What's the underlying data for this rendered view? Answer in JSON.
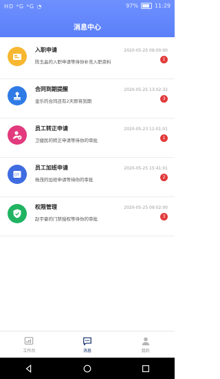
{
  "status": {
    "left": "HD ⁴G ⁴G ◔",
    "battery": "97%",
    "time": "11:29"
  },
  "header": {
    "title": "消息中心"
  },
  "messages": [
    {
      "title": "入职申请",
      "desc": "陈玉晶的入职申请等待你补充入职资料",
      "time": "2020-05-25 09:00:00",
      "badge": "1",
      "color": "#f7b731",
      "icon": "id-card-icon"
    },
    {
      "title": "合同到期提醒",
      "desc": "金乐的合同还有2天即将到期",
      "time": "2020-05-25 13:02:32",
      "badge": "3",
      "color": "#2f7be6",
      "icon": "stamp-icon"
    },
    {
      "title": "员工转正申请",
      "desc": "卫健民的转正申请等待你的审批",
      "time": "2020-05-23 11:01:01",
      "badge": "1",
      "color": "#e23a7c",
      "icon": "verified-user-icon"
    },
    {
      "title": "员工加班申请",
      "desc": "杨茂的加班申请等待你的审批",
      "time": "2020-05-25 15:41:01",
      "badge": "2",
      "color": "#3f6ce1",
      "icon": "overtime-icon"
    },
    {
      "title": "权限管理",
      "desc": "赵宇豪的门禁授权等待你的审批",
      "time": "2020-05-25 09:02:00",
      "badge": "3",
      "color": "#20b361",
      "icon": "shield-check-icon"
    }
  ],
  "tabs": [
    {
      "label": "工作台",
      "icon": "dashboard-icon",
      "active": false
    },
    {
      "label": "消息",
      "icon": "message-icon",
      "active": true
    },
    {
      "label": "我的",
      "icon": "user-icon",
      "active": false
    }
  ]
}
